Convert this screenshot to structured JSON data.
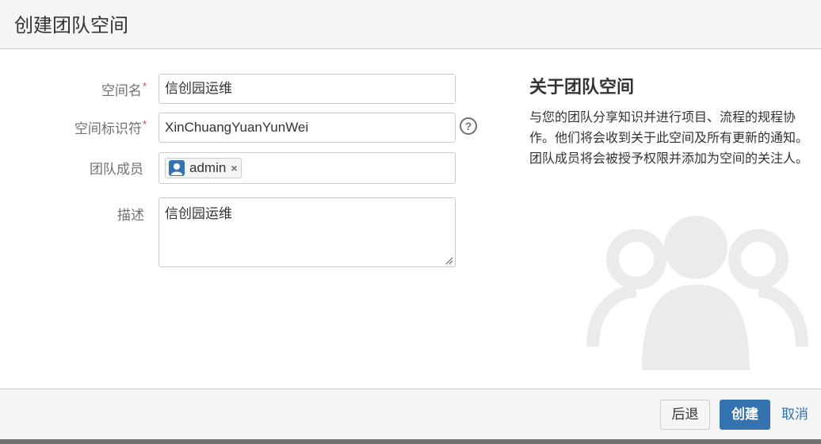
{
  "dialog": {
    "title": "创建团队空间"
  },
  "form": {
    "space_name": {
      "label": "空间名",
      "required_mark": "*",
      "value": "信创园运维"
    },
    "space_key": {
      "label": "空间标识符",
      "required_mark": "*",
      "value": "XinChuangYuanYunWei",
      "help_icon": "question-circle-icon"
    },
    "team_members": {
      "label": "团队成员",
      "members": [
        {
          "name": "admin",
          "avatar_icon": "user-avatar-icon",
          "remove_icon": "close-icon",
          "remove_glyph": "×"
        }
      ]
    },
    "description": {
      "label": "描述",
      "value": "信创园运维"
    }
  },
  "about": {
    "title": "关于团队空间",
    "text": "与您的团队分享知识并进行项目、流程的规程协作。他们将会收到关于此空间及所有更新的通知。团队成员将会被授予权限并添加为空间的关注人。",
    "illustration_icon": "team-group-icon"
  },
  "footer": {
    "back_label": "后退",
    "create_label": "创建",
    "cancel_label": "取消"
  },
  "colors": {
    "primary": "#3572b0",
    "required": "#d04437",
    "label_gray": "#707070",
    "illustration_gray": "#ebebeb",
    "header_bg": "#f5f5f5"
  }
}
